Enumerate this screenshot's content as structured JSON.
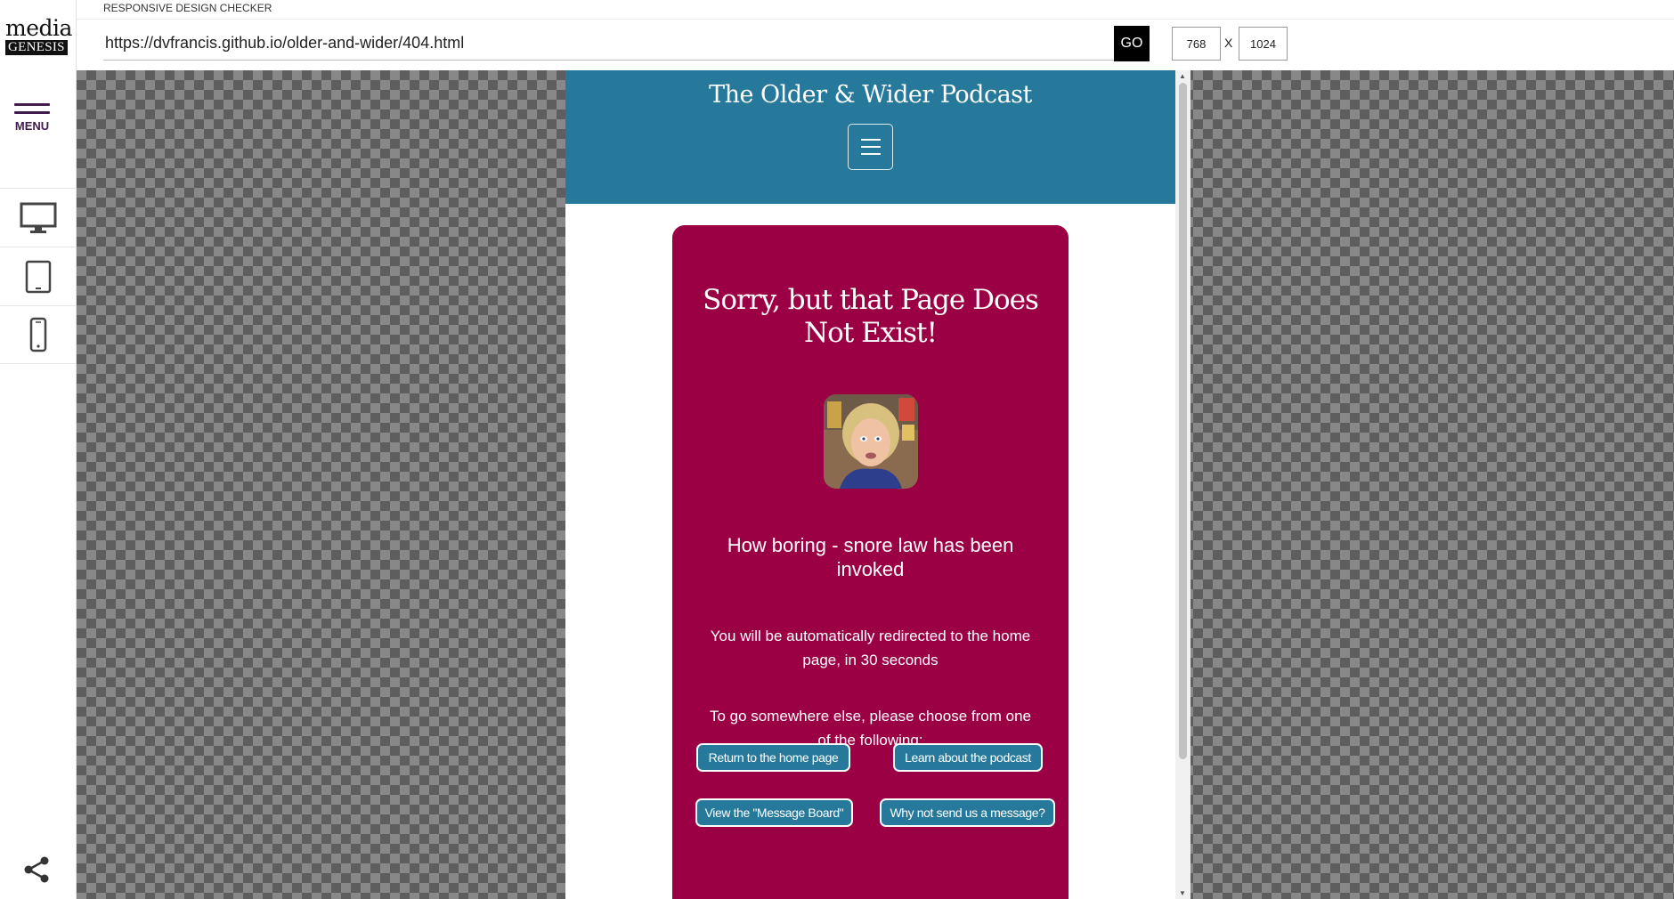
{
  "app": {
    "logo_line1": "media",
    "logo_line2": "GENESIS",
    "title": "RESPONSIVE DESIGN CHECKER",
    "menu_label": "MENU"
  },
  "toolbar": {
    "url": "https://dvfrancis.github.io/older-and-wider/404.html",
    "go_label": "GO",
    "width": "768",
    "height": "1024",
    "separator": "X"
  },
  "sidebar": {
    "devices": [
      {
        "name": "desktop",
        "icon": "monitor-icon"
      },
      {
        "name": "tablet",
        "icon": "tablet-icon"
      },
      {
        "name": "mobile",
        "icon": "phone-icon"
      }
    ],
    "share_icon": "share-icon"
  },
  "site": {
    "title": "The Older & Wider Podcast",
    "header_color": "#27799b",
    "card_color": "#9c0044",
    "heading": "Sorry, but that Page Does Not Exist!",
    "subheading": "How boring - snore law has been invoked",
    "redirect_text": "You will be automatically redirected to the home page, in 30 seconds",
    "choose_text": "To go somewhere else, please choose from one of the following:",
    "buttons": [
      "Return to the home page",
      "Learn about the podcast",
      "View the \"Message Board\"",
      "Why not send us a message?"
    ]
  }
}
